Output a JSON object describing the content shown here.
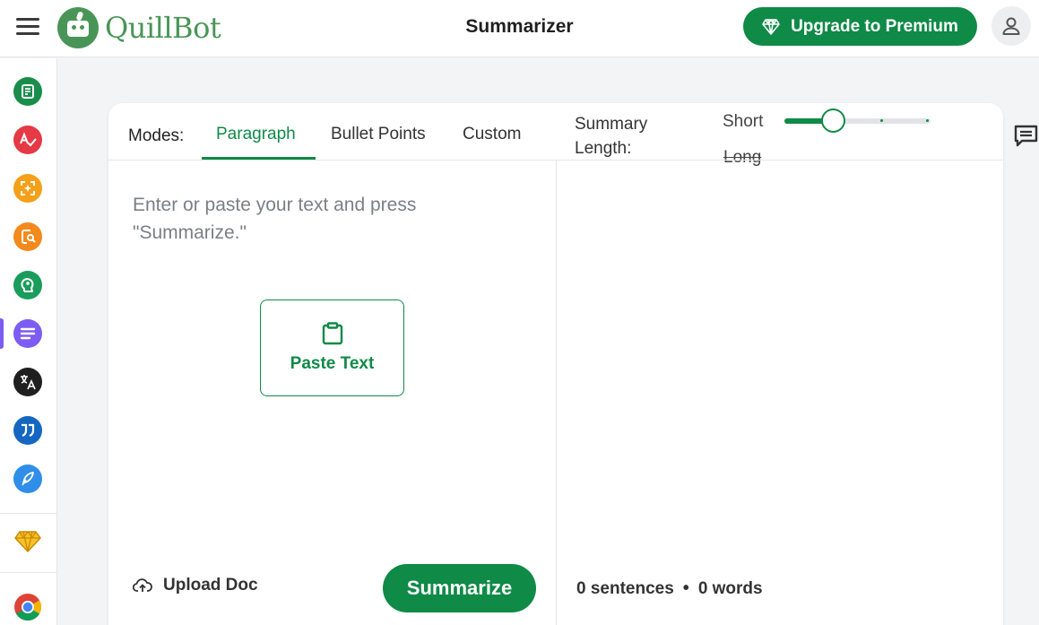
{
  "header": {
    "logo_text": "QuillBot",
    "page_title": "Summarizer",
    "upgrade_label": "Upgrade to Premium"
  },
  "sidebar": {
    "items": [
      {
        "name": "paraphraser",
        "color": "#1a8d4b"
      },
      {
        "name": "grammar-checker",
        "color": "#e53945"
      },
      {
        "name": "ai-detector",
        "color": "#f4a019"
      },
      {
        "name": "plagiarism-checker",
        "color": "#f28a1d"
      },
      {
        "name": "ai-humanizer",
        "color": "#1a9d5b"
      },
      {
        "name": "summarizer",
        "color": "#7c5cf2"
      },
      {
        "name": "translator",
        "color": "#1f1f1f"
      },
      {
        "name": "citation-generator",
        "color": "#1566c0"
      },
      {
        "name": "quillbot-flow",
        "color": "#2f8ee8"
      },
      {
        "name": "premium",
        "color": "#e1a313"
      },
      {
        "name": "chrome-extension",
        "color": "#db4437"
      }
    ]
  },
  "modes": {
    "label": "Modes:",
    "tabs": [
      {
        "label": "Paragraph",
        "active": true
      },
      {
        "label": "Bullet Points",
        "active": false
      },
      {
        "label": "Custom",
        "active": false
      }
    ]
  },
  "summary_length": {
    "label_line1": "Summary",
    "label_line2": "Length:",
    "short_label": "Short",
    "long_label": "Long",
    "value": 0.33
  },
  "editor": {
    "placeholder": "Enter or paste your text and press \"Summarize.\"",
    "paste_label": "Paste Text",
    "upload_label": "Upload Doc",
    "summarize_label": "Summarize"
  },
  "output": {
    "sentences": "0 sentences",
    "separator": "•",
    "words": "0 words"
  },
  "colors": {
    "brand": "#0f8a47",
    "logo": "#499557"
  }
}
